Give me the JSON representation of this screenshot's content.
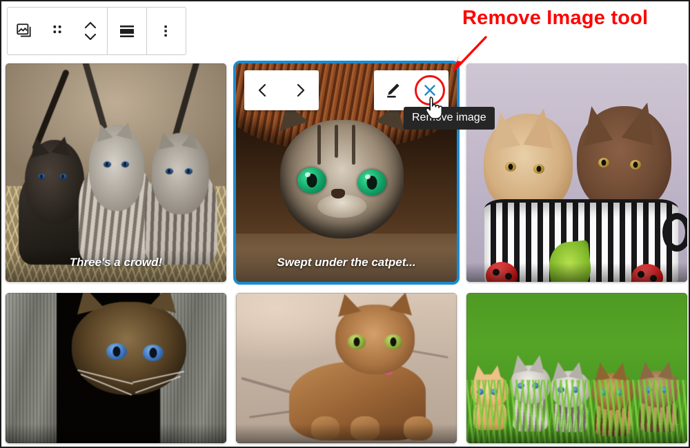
{
  "toolbar": {
    "buttons": [
      {
        "name": "gallery-block-icon",
        "label": "Gallery block type"
      },
      {
        "name": "drag-handle-icon",
        "label": "Drag"
      },
      {
        "name": "move-updown-icon",
        "label": "Move up or down"
      },
      {
        "name": "align-icon",
        "label": "Change alignment"
      },
      {
        "name": "more-options-icon",
        "label": "Options"
      }
    ]
  },
  "annotation": {
    "text": "Remove Image tool",
    "color": "#ff0000"
  },
  "tooltip": {
    "text": "Remove image",
    "background": "#262626",
    "color": "#ffffff"
  },
  "image_controls": {
    "previous_label": "Previous",
    "next_label": "Next",
    "edit_label": "Edit image",
    "remove_label": "Remove image",
    "highlight_color": "#ee1111",
    "remove_icon_color": "#1e88c7"
  },
  "selection": {
    "border_color": "#1a8cd0",
    "selected_index": 1
  },
  "gallery": {
    "columns": 3,
    "items": [
      {
        "index": 0,
        "name": "gallery-image-three-kittens",
        "caption": "Three's a crowd!",
        "alt": "Three kittens sitting on hay",
        "selected": false
      },
      {
        "index": 1,
        "name": "gallery-image-catpet",
        "caption": "Swept under the catpet...",
        "alt": "Green-eyed tabby cat peeking from under a rug",
        "selected": true
      },
      {
        "index": 2,
        "name": "gallery-image-mug-kittens",
        "caption": "",
        "alt": "Two Burmese kittens in a striped mug",
        "selected": false
      },
      {
        "index": 3,
        "name": "gallery-image-fence-kitten",
        "caption": "",
        "alt": "Dark tabby kitten peeking through a wooden fence",
        "selected": false
      },
      {
        "index": 4,
        "name": "gallery-image-ground-tabby",
        "caption": "",
        "alt": "Orange tabby cat lying on concrete",
        "selected": false
      },
      {
        "index": 5,
        "name": "gallery-image-grass-kittens",
        "caption": "",
        "alt": "Five kittens sitting in green grass",
        "selected": false
      }
    ]
  }
}
